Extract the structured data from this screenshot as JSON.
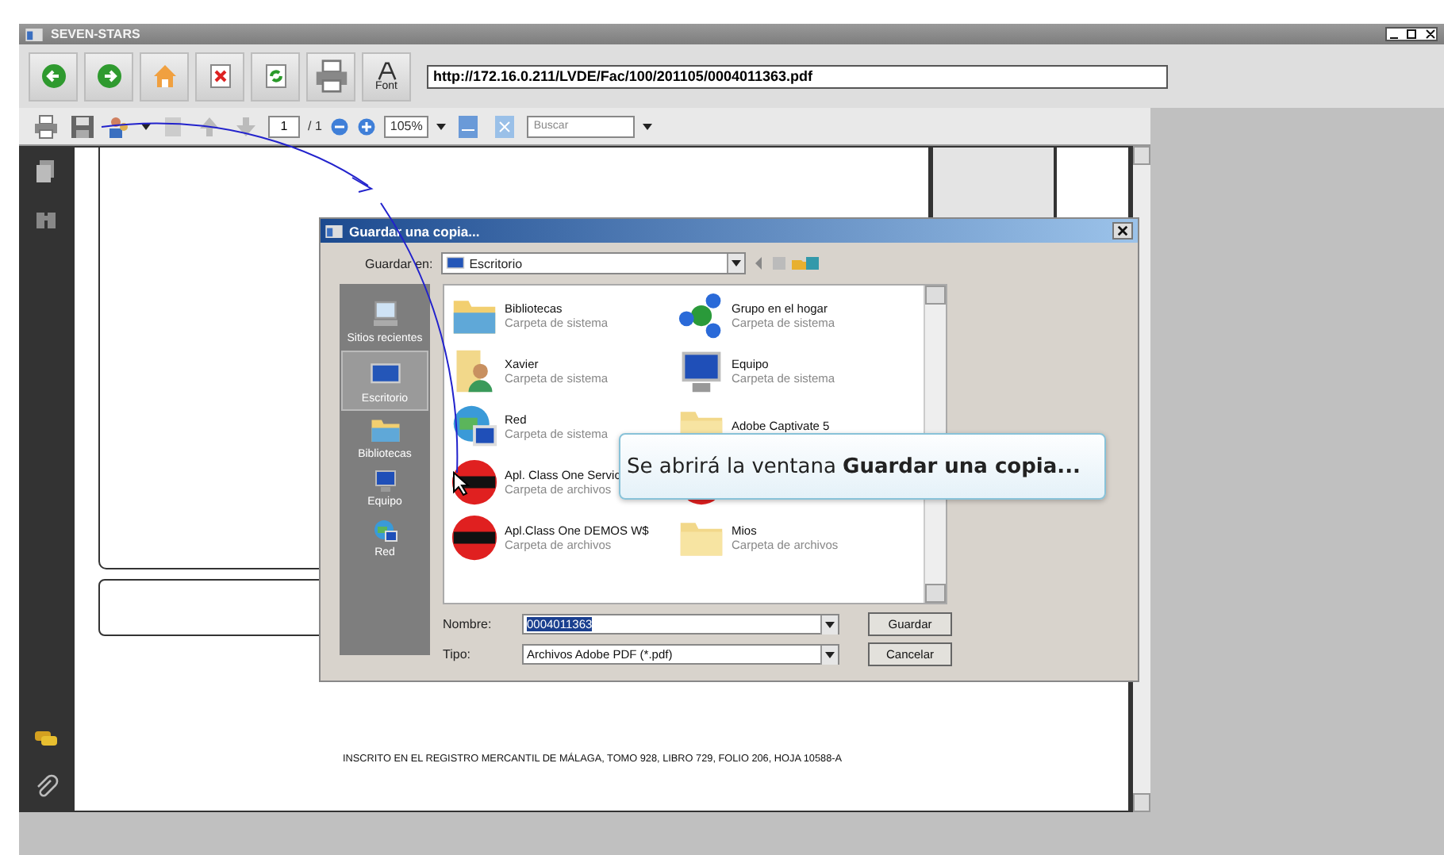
{
  "app_window": {
    "title": "SEVEN-STARS"
  },
  "main_toolbar": {
    "buttons": [
      {
        "kind": "back"
      },
      {
        "kind": "forward"
      },
      {
        "kind": "home"
      },
      {
        "kind": "close"
      },
      {
        "kind": "refresh"
      },
      {
        "kind": "print"
      },
      {
        "kind": "font",
        "label": "Font"
      }
    ],
    "url": "http://172.16.0.211/LVDE/Fac/100/201105/0004011363.pdf"
  },
  "pdf_toolbar": {
    "page": "1",
    "page_total": "/ 1",
    "zoom": "105%",
    "search_placeholder": "Buscar"
  },
  "document": {
    "footer_text": "INSCRITO EN EL REGISTRO MERCANTIL DE MÁLAGA, TOMO 928, LIBRO 729, FOLIO 206, HOJA 10588-A"
  },
  "dialog": {
    "title": "Guardar una copia...",
    "save_in_label": "Guardar en:",
    "save_in_value": "Escritorio",
    "places": [
      {
        "label": "Sitios recientes",
        "kind": "recent",
        "selected": false
      },
      {
        "label": "Escritorio",
        "kind": "desktop",
        "selected": true
      },
      {
        "label": "Bibliotecas",
        "kind": "library",
        "selected": false
      },
      {
        "label": "Equipo",
        "kind": "computer",
        "selected": false
      },
      {
        "label": "Red",
        "kind": "network",
        "selected": false
      }
    ],
    "files": [
      {
        "name": "Bibliotecas",
        "type": "Carpeta de sistema",
        "kind": "library"
      },
      {
        "name": "Grupo en el hogar",
        "type": "Carpeta de sistema",
        "kind": "homegroup"
      },
      {
        "name": "Xavier",
        "type": "Carpeta de sistema",
        "kind": "user"
      },
      {
        "name": "Equipo",
        "type": "Carpeta de sistema",
        "kind": "computer"
      },
      {
        "name": "Red",
        "type": "Carpeta de sistema",
        "kind": "network"
      },
      {
        "name": "Adobe Captivate 5",
        "kind": "folder"
      },
      {
        "name": "Apl. Class One Servic",
        "type": "Carpeta de archivos",
        "kind": "app"
      },
      {
        "kind": "app"
      },
      {
        "name": "Apl.Class One DEMOS W$",
        "type": "Carpeta de archivos",
        "kind": "app"
      },
      {
        "name": "Mios",
        "type": "Carpeta de archivos",
        "kind": "folder"
      }
    ],
    "filename_label": "Nombre:",
    "filename": "0004011363",
    "filetype_label": "Tipo:",
    "filetype": "Archivos Adobe PDF (*.pdf)",
    "buttons": [
      "Guardar",
      "Cancelar"
    ]
  },
  "tooltip": {
    "text": "Se abrirá la ventana **Guardar una copia...**"
  }
}
